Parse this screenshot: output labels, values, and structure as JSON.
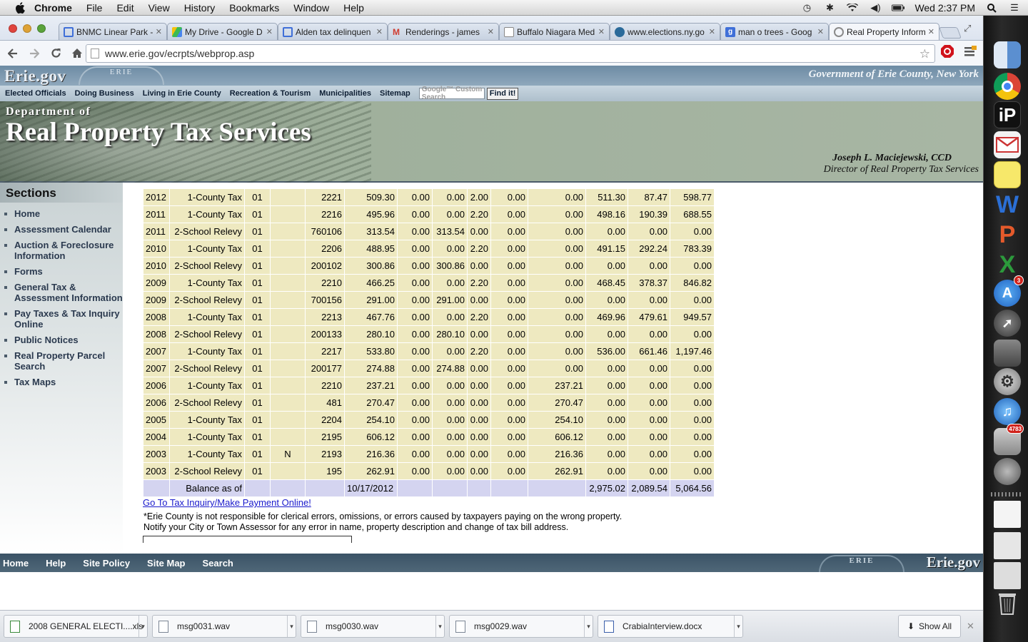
{
  "menubar": {
    "app": "Chrome",
    "items": [
      "File",
      "Edit",
      "View",
      "History",
      "Bookmarks",
      "Window",
      "Help"
    ],
    "clock": "Wed 2:37 PM"
  },
  "tabs": [
    {
      "label": "BNMC Linear Park -",
      "color": "#3f6fd8"
    },
    {
      "label": "My Drive - Google D",
      "color": "#2fa84f"
    },
    {
      "label": "Alden tax delinquen",
      "color": "#3f6fd8"
    },
    {
      "label": "Renderings - james",
      "color": "#d03b2f"
    },
    {
      "label": "Buffalo Niagara Med",
      "color": "#ffffff"
    },
    {
      "label": "www.elections.ny.go",
      "color": "#2a6a9a"
    },
    {
      "label": "man o trees - Goog",
      "color": "#3f6fd8"
    },
    {
      "label": "Real Property Inform",
      "color": "#8a8a8a",
      "active": true
    }
  ],
  "address": {
    "url": "www.erie.gov/ecrpts/webprop.asp"
  },
  "site": {
    "logo": "Erie.gov",
    "seal_text": "ERIE",
    "gov_title": "Government of Erie County, New York",
    "nav": [
      "Elected Officials",
      "Doing Business",
      "Living in Erie County",
      "Recreation & Tourism",
      "Municipalities",
      "Sitemap"
    ],
    "search_placeholder": "Google™ Custom Search",
    "find_button": "Find it!",
    "dept_of": "Department of",
    "dept_name": "Real Property Tax Services",
    "director_name": "Joseph L. Maciejewski, CCD",
    "director_title": "Director of Real Property Tax Services"
  },
  "sidebar": {
    "heading": "Sections",
    "items": [
      [
        "Home"
      ],
      [
        "Assessment Calendar"
      ],
      [
        "Auction & Foreclosure",
        "Information"
      ],
      [
        "Forms"
      ],
      [
        "General Tax &",
        "Assessment Information"
      ],
      [
        "Pay Taxes & Tax Inquiry",
        "Online"
      ],
      [
        "Public Notices"
      ],
      [
        "Real Property Parcel",
        "Search"
      ],
      [
        "Tax Maps"
      ]
    ]
  },
  "tax_rows": [
    [
      "2012",
      "1-County Tax",
      "01",
      "",
      "2221",
      "509.30",
      "0.00",
      "0.00",
      "2.00",
      "0.00",
      "0.00",
      "511.30",
      "87.47",
      "598.77"
    ],
    [
      "2011",
      "1-County Tax",
      "01",
      "",
      "2216",
      "495.96",
      "0.00",
      "0.00",
      "2.20",
      "0.00",
      "0.00",
      "498.16",
      "190.39",
      "688.55"
    ],
    [
      "2011",
      "2-School Relevy",
      "01",
      "",
      "760106",
      "313.54",
      "0.00",
      "313.54",
      "0.00",
      "0.00",
      "0.00",
      "0.00",
      "0.00",
      "0.00"
    ],
    [
      "2010",
      "1-County Tax",
      "01",
      "",
      "2206",
      "488.95",
      "0.00",
      "0.00",
      "2.20",
      "0.00",
      "0.00",
      "491.15",
      "292.24",
      "783.39"
    ],
    [
      "2010",
      "2-School Relevy",
      "01",
      "",
      "200102",
      "300.86",
      "0.00",
      "300.86",
      "0.00",
      "0.00",
      "0.00",
      "0.00",
      "0.00",
      "0.00"
    ],
    [
      "2009",
      "1-County Tax",
      "01",
      "",
      "2210",
      "466.25",
      "0.00",
      "0.00",
      "2.20",
      "0.00",
      "0.00",
      "468.45",
      "378.37",
      "846.82"
    ],
    [
      "2009",
      "2-School Relevy",
      "01",
      "",
      "700156",
      "291.00",
      "0.00",
      "291.00",
      "0.00",
      "0.00",
      "0.00",
      "0.00",
      "0.00",
      "0.00"
    ],
    [
      "2008",
      "1-County Tax",
      "01",
      "",
      "2213",
      "467.76",
      "0.00",
      "0.00",
      "2.20",
      "0.00",
      "0.00",
      "469.96",
      "479.61",
      "949.57"
    ],
    [
      "2008",
      "2-School Relevy",
      "01",
      "",
      "200133",
      "280.10",
      "0.00",
      "280.10",
      "0.00",
      "0.00",
      "0.00",
      "0.00",
      "0.00",
      "0.00"
    ],
    [
      "2007",
      "1-County Tax",
      "01",
      "",
      "2217",
      "533.80",
      "0.00",
      "0.00",
      "2.20",
      "0.00",
      "0.00",
      "536.00",
      "661.46",
      "1,197.46"
    ],
    [
      "2007",
      "2-School Relevy",
      "01",
      "",
      "200177",
      "274.88",
      "0.00",
      "274.88",
      "0.00",
      "0.00",
      "0.00",
      "0.00",
      "0.00",
      "0.00"
    ],
    [
      "2006",
      "1-County Tax",
      "01",
      "",
      "2210",
      "237.21",
      "0.00",
      "0.00",
      "0.00",
      "0.00",
      "237.21",
      "0.00",
      "0.00",
      "0.00"
    ],
    [
      "2006",
      "2-School Relevy",
      "01",
      "",
      "481",
      "270.47",
      "0.00",
      "0.00",
      "0.00",
      "0.00",
      "270.47",
      "0.00",
      "0.00",
      "0.00"
    ],
    [
      "2005",
      "1-County Tax",
      "01",
      "",
      "2204",
      "254.10",
      "0.00",
      "0.00",
      "0.00",
      "0.00",
      "254.10",
      "0.00",
      "0.00",
      "0.00"
    ],
    [
      "2004",
      "1-County Tax",
      "01",
      "",
      "2195",
      "606.12",
      "0.00",
      "0.00",
      "0.00",
      "0.00",
      "606.12",
      "0.00",
      "0.00",
      "0.00"
    ],
    [
      "2003",
      "1-County Tax",
      "01",
      "N",
      "2193",
      "216.36",
      "0.00",
      "0.00",
      "0.00",
      "0.00",
      "216.36",
      "0.00",
      "0.00",
      "0.00"
    ],
    [
      "2003",
      "2-School Relevy",
      "01",
      "",
      "195",
      "262.91",
      "0.00",
      "0.00",
      "0.00",
      "0.00",
      "262.91",
      "0.00",
      "0.00",
      "0.00"
    ]
  ],
  "balance_row": {
    "label": "Balance as of",
    "date": "10/17/2012",
    "total1": "2,975.02",
    "total2": "2,089.54",
    "total3": "5,064.56"
  },
  "pay_link": "Go To Tax Inquiry/Make Payment Online!",
  "disclaimer1": "*Erie County is not responsible for clerical errors, omissions, or errors caused by taxpayers paying on the wrong property.",
  "disclaimer2": "Notify your City or Town Assessor for any error in name, property description and change of tax bill address.",
  "footer": {
    "links": [
      "Home",
      "Help",
      "Site Policy",
      "Site Map",
      "Search"
    ],
    "logo": "Erie.gov",
    "seal_text": "ERIE"
  },
  "downloads": {
    "items": [
      {
        "name": "2008 GENERAL ELECTI....xls",
        "type": "xls"
      },
      {
        "name": "msg0031.wav",
        "type": "wav"
      },
      {
        "name": "msg0030.wav",
        "type": "wav"
      },
      {
        "name": "msg0029.wav",
        "type": "wav"
      },
      {
        "name": "CrabiaInterview.docx",
        "type": "doc"
      }
    ],
    "show_all": "Show All"
  },
  "dock": {
    "ipulse_label": "iP",
    "word_label": "W",
    "powerpoint_label": "P",
    "excel_label": "X",
    "appstore_badge": "3",
    "photos_badge": "4783"
  }
}
